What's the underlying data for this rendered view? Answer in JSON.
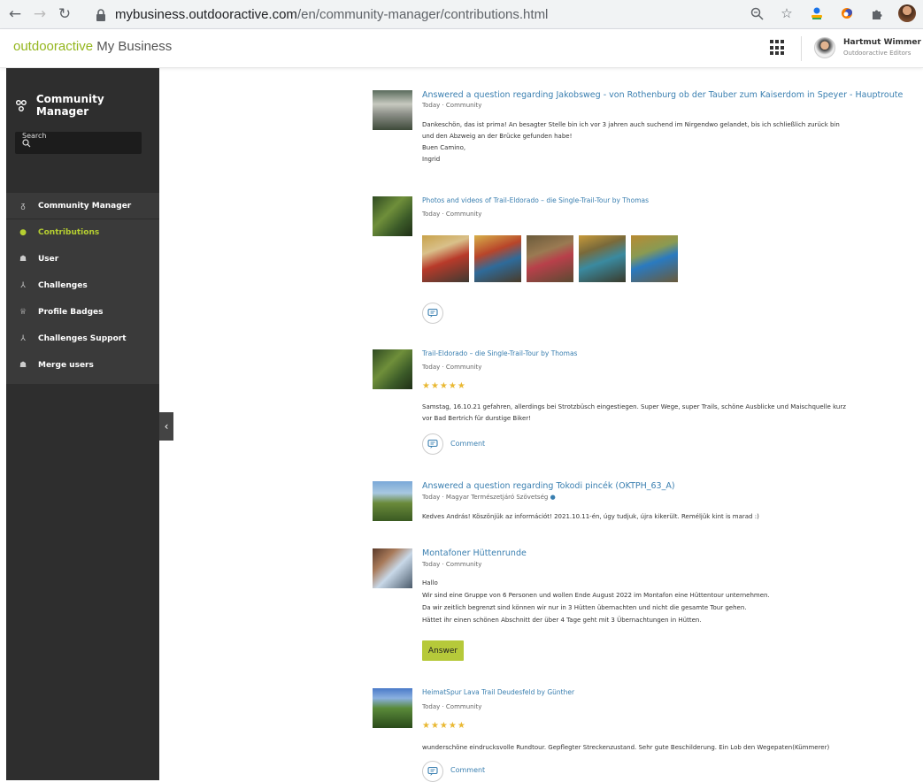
{
  "browser": {
    "url_host": "mybusiness.outdooractive.com",
    "url_path": "/en/community-manager/contributions.html",
    "icons": [
      "back-icon",
      "forward-icon",
      "reload-icon",
      "lock-icon",
      "zoom-icon",
      "star-icon",
      "extension-icons",
      "puzzle-icon",
      "profile-avatar"
    ]
  },
  "header": {
    "brand_accent": "outdooractive",
    "brand_rest": "My Business",
    "user_name": "Hartmut Wimmer",
    "user_org": "Outdooractive Editors"
  },
  "sidebar": {
    "title": "Community Manager",
    "search_placeholder": "Search",
    "items": [
      {
        "label": "Community Manager",
        "icon": "community-icon"
      },
      {
        "label": "Contributions",
        "icon": "contributions-icon"
      },
      {
        "label": "User",
        "icon": "users-icon"
      },
      {
        "label": "Challenges",
        "icon": "challenges-icon"
      },
      {
        "label": "Profile Badges",
        "icon": "badge-icon"
      },
      {
        "label": "Challenges Support",
        "icon": "challenges-support-icon"
      },
      {
        "label": "Merge users",
        "icon": "merge-users-icon"
      }
    ]
  },
  "posts": [
    {
      "title": "Answered a question regarding Jakobsweg - von Rothenburg ob der Tauber zum Kaiserdom in Speyer - Hauptroute",
      "meta": "Today · Community",
      "lines": [
        "Dankeschön, das ist prima! An besagter Stelle bin ich vor 3 jahren auch suchend im Nirgendwo gelandet, bis ich schließlich zurück bin",
        "und den Abzweig an der Brücke gefunden habe!",
        "Buen Camino,",
        "Ingrid"
      ]
    },
    {
      "title": "Photos and videos of Trail-Eldorado – die Single-Trail-Tour by Thomas",
      "meta": "Today · Community"
    },
    {
      "title": "Trail-Eldorado – die Single-Trail-Tour by Thomas",
      "meta": "Today · Community",
      "stars": "★★★★★",
      "lines": [
        "Samstag, 16.10.21 gefahren, allerdings bei Strotzbüsch eingestiegen. Super Wege, super Trails, schöne Ausblicke und Maischquelle kurz",
        "vor Bad Bertrich für durstige Biker!"
      ],
      "comment": "Comment"
    },
    {
      "title": "Answered a question regarding Tokodi pincék (OKTPH_63_A)",
      "meta": "Today · Magyar Természetjáró Szövetség",
      "lines": [
        "Kedves András! Köszönjük az információt! 2021.10.11-én, úgy tudjuk, újra kikerült. Reméljük kint is marad :)"
      ]
    },
    {
      "title": "Montafoner Hüttenrunde",
      "meta": "Today · Community",
      "lines": [
        "Hallo",
        "Wir sind eine Gruppe von 6 Personen und wollen Ende August 2022 im Montafon eine Hüttentour unternehmen.",
        "Da wir zeitlich begrenzt sind können wir nur in 3 Hütten übernachten und nicht die gesamte Tour gehen.",
        "Hättet ihr einen schönen Abschnitt der über 4 Tage geht mit 3 Übernachtungen in Hütten."
      ],
      "answer": "Answer"
    },
    {
      "title": "HeimatSpur Lava Trail Deudesfeld by Günther",
      "meta": "Today · Community",
      "stars": "★★★★★",
      "lines": [
        "wunderschöne eindrucksvolle Rundtour. Gepflegter Streckenzustand. Sehr gute Beschilderung. Ein Lob den Wegepaten(Kümmerer)"
      ],
      "comment": "Comment"
    }
  ],
  "colors": {
    "brand_green": "#94b61e",
    "active_menu": "#b6cf31",
    "link_blue": "#3a7fb0",
    "star": "#e9b832",
    "answer_btn": "#b6c93a"
  }
}
